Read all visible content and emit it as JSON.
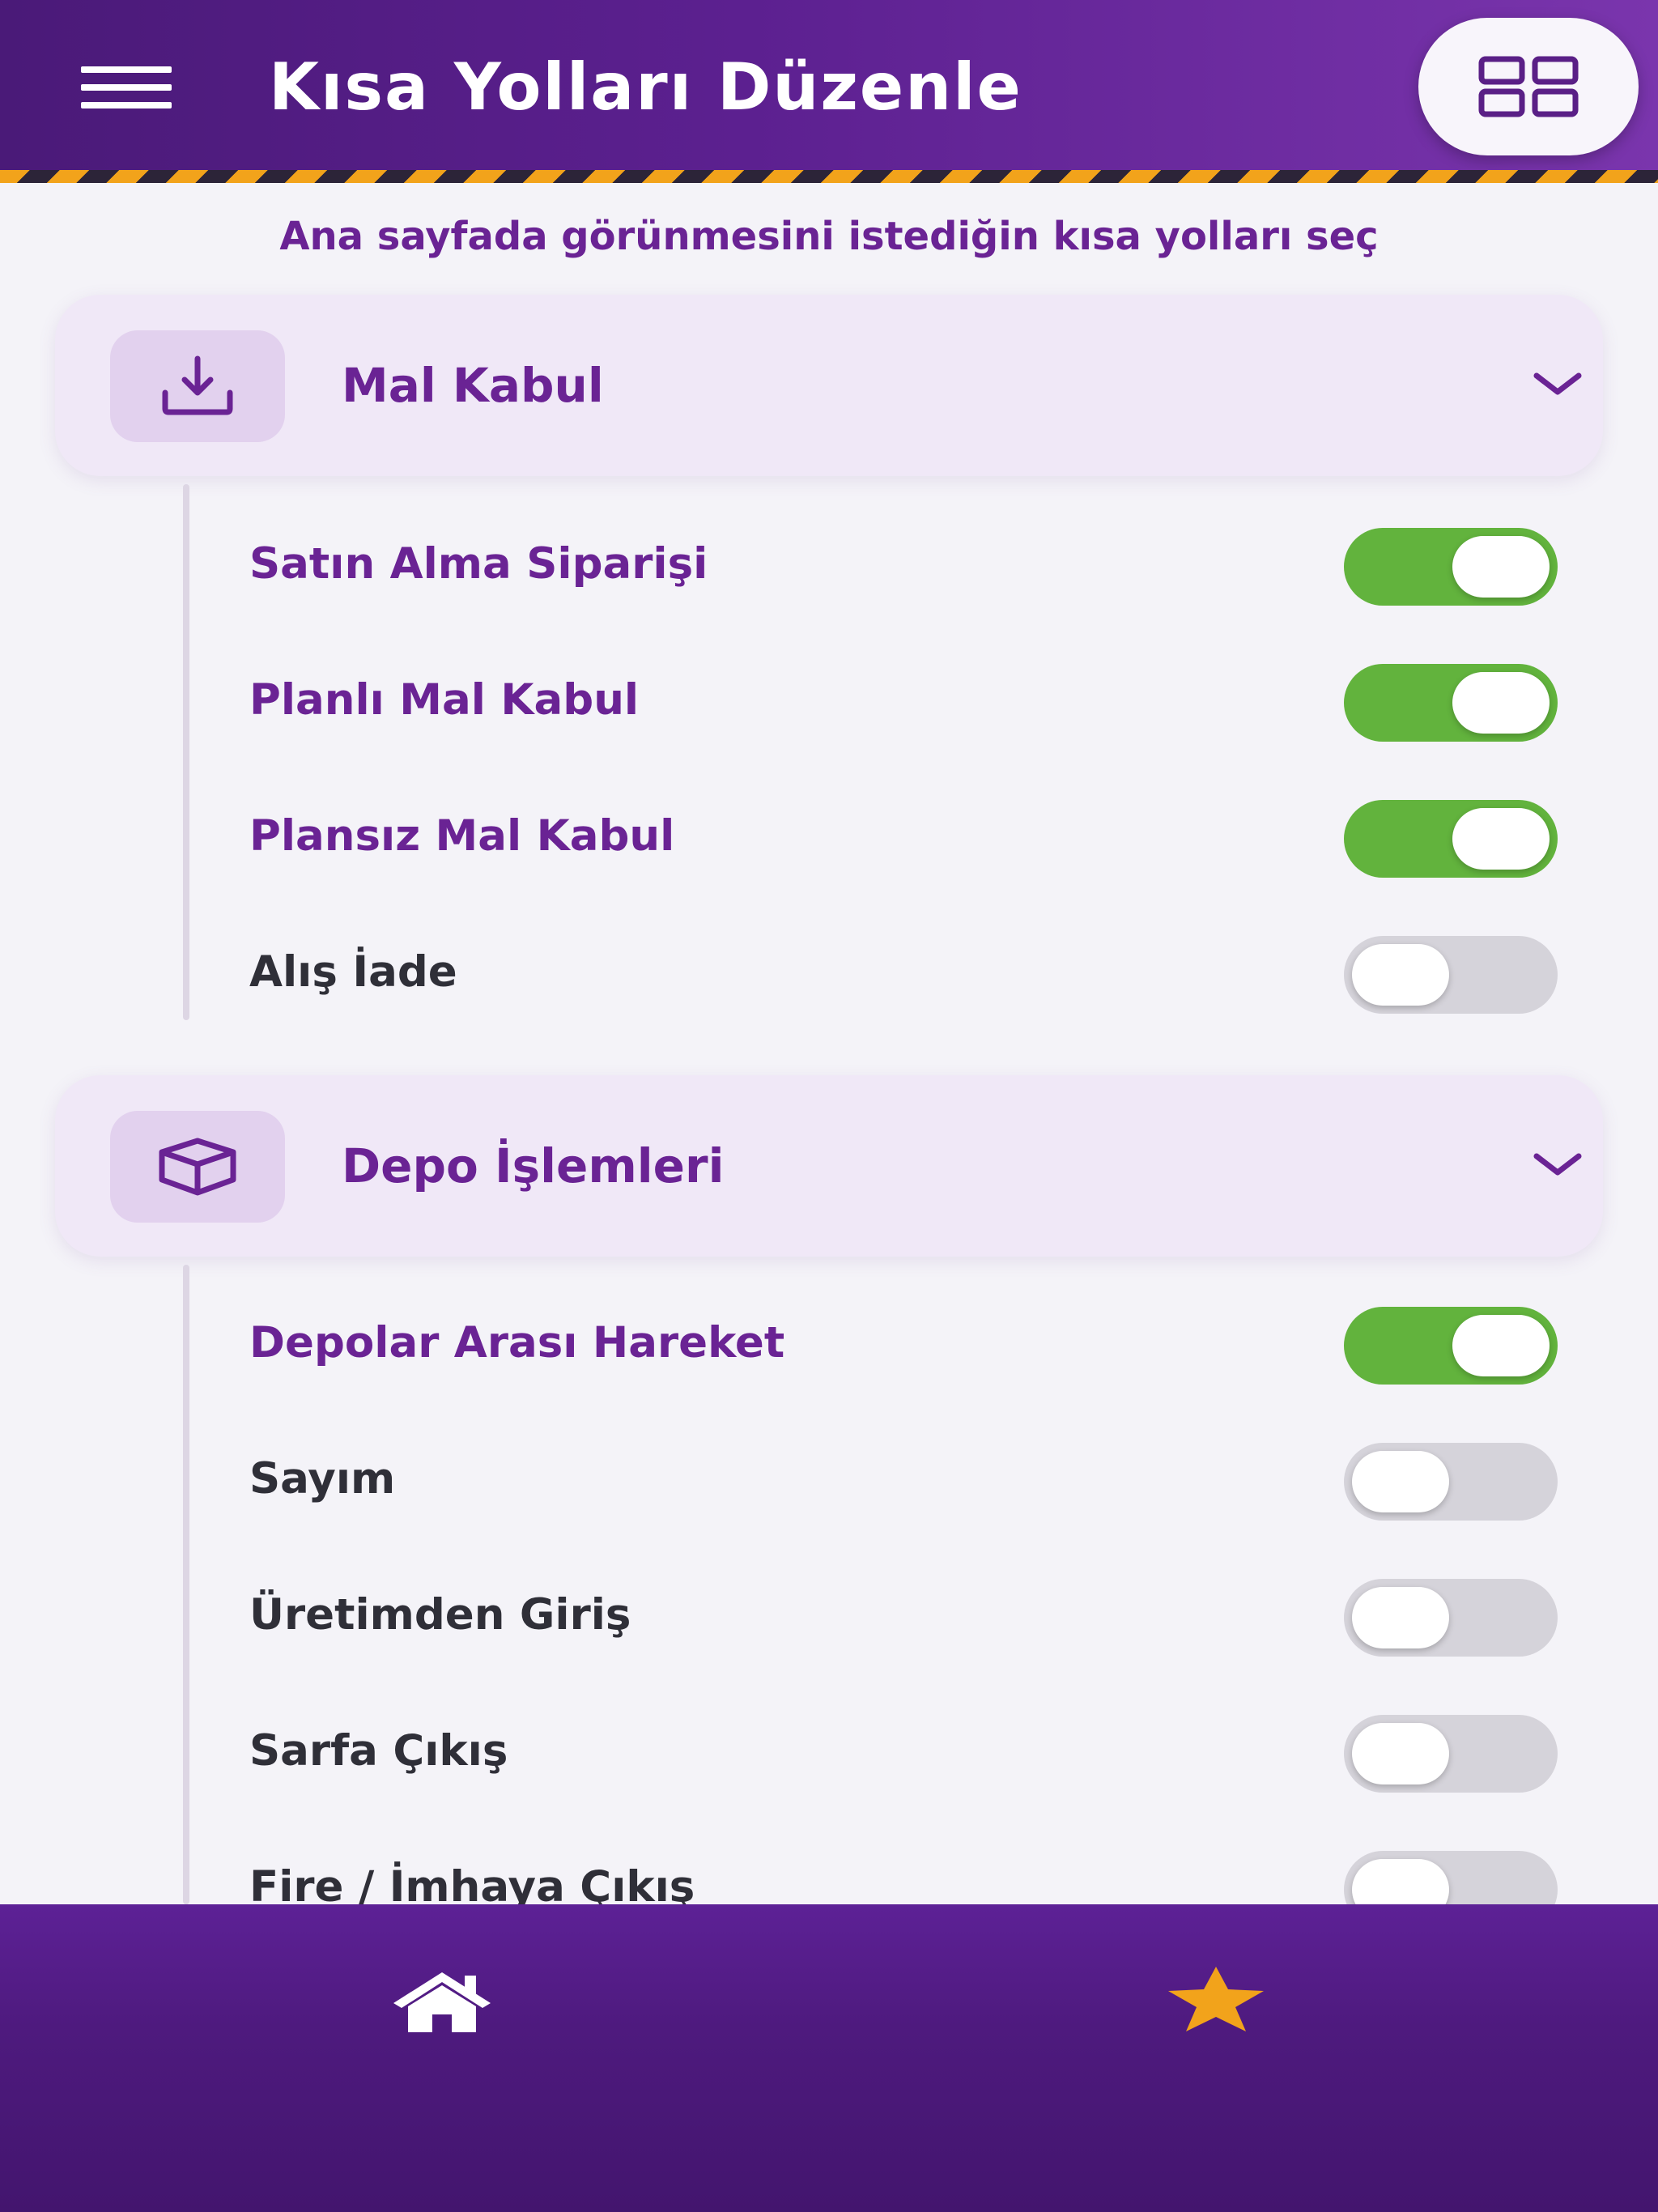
{
  "header": {
    "title": "Kısa Yolları Düzenle",
    "menu_icon": "hamburger-menu-icon",
    "grid_icon": "grid-view-icon"
  },
  "subtitle": "Ana sayfada görünmesini istediğin kısa yolları seç",
  "sections": [
    {
      "title": "Mal Kabul",
      "icon": "download-tray-icon",
      "expanded": true,
      "items": [
        {
          "label": "Satın Alma Siparişi",
          "enabled": true
        },
        {
          "label": "Planlı Mal Kabul",
          "enabled": true
        },
        {
          "label": "Plansız Mal Kabul",
          "enabled": true
        },
        {
          "label": "Alış İade",
          "enabled": false
        }
      ]
    },
    {
      "title": "Depo İşlemleri",
      "icon": "box-icon",
      "expanded": true,
      "items": [
        {
          "label": "Depolar Arası Hareket",
          "enabled": true
        },
        {
          "label": "Sayım",
          "enabled": false
        },
        {
          "label": "Üretimden Giriş",
          "enabled": false
        },
        {
          "label": "Sarfa Çıkış",
          "enabled": false
        },
        {
          "label": "Fire / İmhaya Çıkış",
          "enabled": false
        }
      ]
    }
  ],
  "bottom_nav": {
    "home_icon": "home-icon",
    "favorites_icon": "star-icon"
  },
  "colors": {
    "primary": "#5c2090",
    "accent_text": "#6a2394",
    "toggle_on": "#62b33d",
    "toggle_off": "#d5d3da",
    "star": "#f2a31b"
  }
}
